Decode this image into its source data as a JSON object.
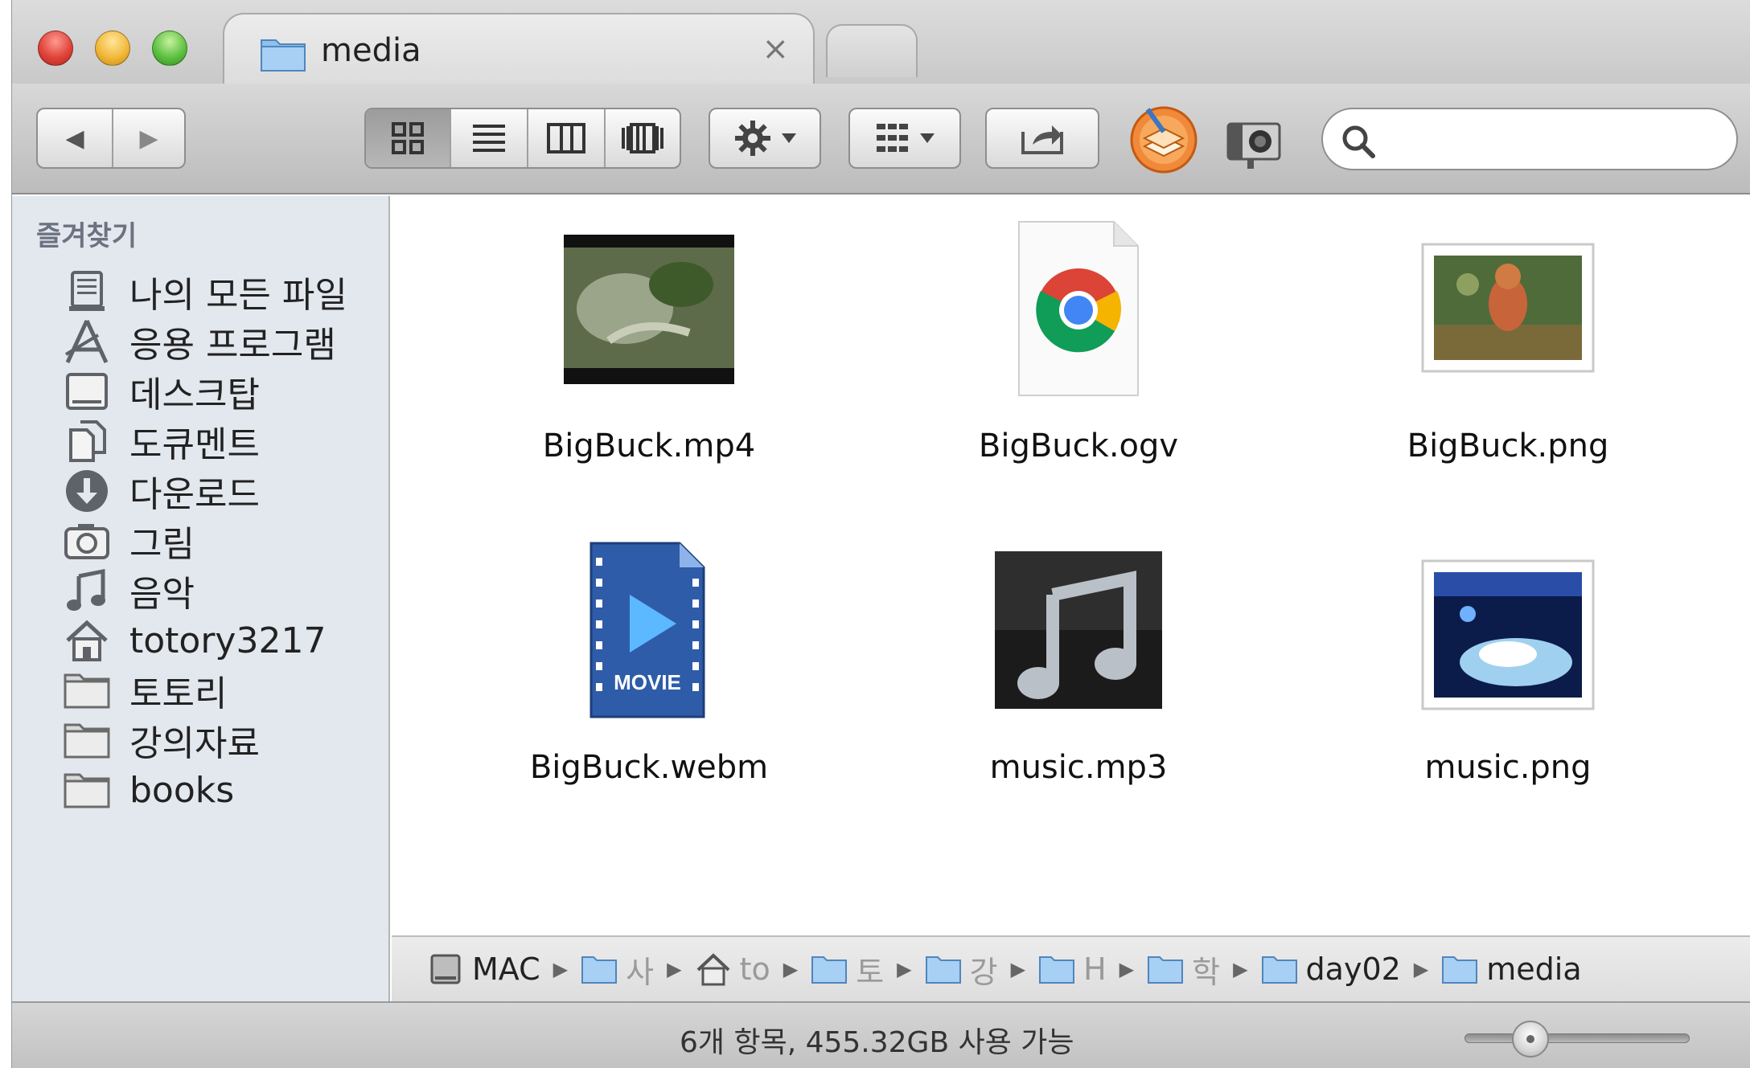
{
  "window": {
    "tab": {
      "title": "media",
      "close_glyph": "×"
    }
  },
  "toolbar": {
    "back_label": "◀",
    "forward_label": "▶",
    "view_modes": [
      "icon-view",
      "list-view",
      "column-view",
      "cover-flow-view"
    ],
    "active_view": "icon-view",
    "action_menu_icon": "gear-icon",
    "arrange_menu_icon": "grid-arrange-icon",
    "share_icon": "share-icon",
    "search": {
      "value": "",
      "placeholder": ""
    }
  },
  "sidebar": {
    "heading": "즐겨찾기",
    "items": [
      {
        "label": "나의 모든 파일",
        "icon": "all-files-icon"
      },
      {
        "label": "응용 프로그램",
        "icon": "applications-icon"
      },
      {
        "label": "데스크탑",
        "icon": "desktop-icon"
      },
      {
        "label": "도큐멘트",
        "icon": "documents-icon"
      },
      {
        "label": "다운로드",
        "icon": "downloads-icon"
      },
      {
        "label": "그림",
        "icon": "pictures-icon"
      },
      {
        "label": "음악",
        "icon": "music-icon"
      },
      {
        "label": "totory3217",
        "icon": "home-icon"
      },
      {
        "label": "토토리",
        "icon": "folder-icon"
      },
      {
        "label": "강의자료",
        "icon": "folder-icon"
      },
      {
        "label": "books",
        "icon": "folder-icon"
      }
    ]
  },
  "files": [
    {
      "name": "BigBuck.mp4",
      "icon": "video-thumbnail-icon"
    },
    {
      "name": "BigBuck.ogv",
      "icon": "chrome-document-icon"
    },
    {
      "name": "BigBuck.png",
      "icon": "image-thumbnail-icon"
    },
    {
      "name": "BigBuck.webm",
      "icon": "movie-document-icon"
    },
    {
      "name": "music.mp3",
      "icon": "music-note-icon"
    },
    {
      "name": "music.png",
      "icon": "image-thumbnail-icon"
    }
  ],
  "pathbar": {
    "crumbs": [
      {
        "label": "MAC",
        "icon": "hard-drive-icon",
        "faded": false
      },
      {
        "label": "사",
        "icon": "users-folder-icon",
        "faded": true
      },
      {
        "label": "to",
        "icon": "home-icon",
        "faded": true
      },
      {
        "label": "토",
        "icon": "folder-icon",
        "faded": true
      },
      {
        "label": "강",
        "icon": "folder-icon",
        "faded": true
      },
      {
        "label": "H",
        "icon": "folder-icon",
        "faded": true
      },
      {
        "label": "학",
        "icon": "folder-icon",
        "faded": true
      },
      {
        "label": "day02",
        "icon": "folder-icon",
        "faded": false
      },
      {
        "label": "media",
        "icon": "folder-icon",
        "faded": false
      }
    ],
    "separator": "▶"
  },
  "statusbar": {
    "text": "6개 항목, 455.32GB 사용 가능",
    "icon_size_value": 0.25
  },
  "colors": {
    "sidebar_bg": "#e3e8ee",
    "folder_blue": "#7fb2e5",
    "close_red": "#e0443a",
    "minimize_yellow": "#f2b93b",
    "zoom_green": "#5fc243"
  }
}
